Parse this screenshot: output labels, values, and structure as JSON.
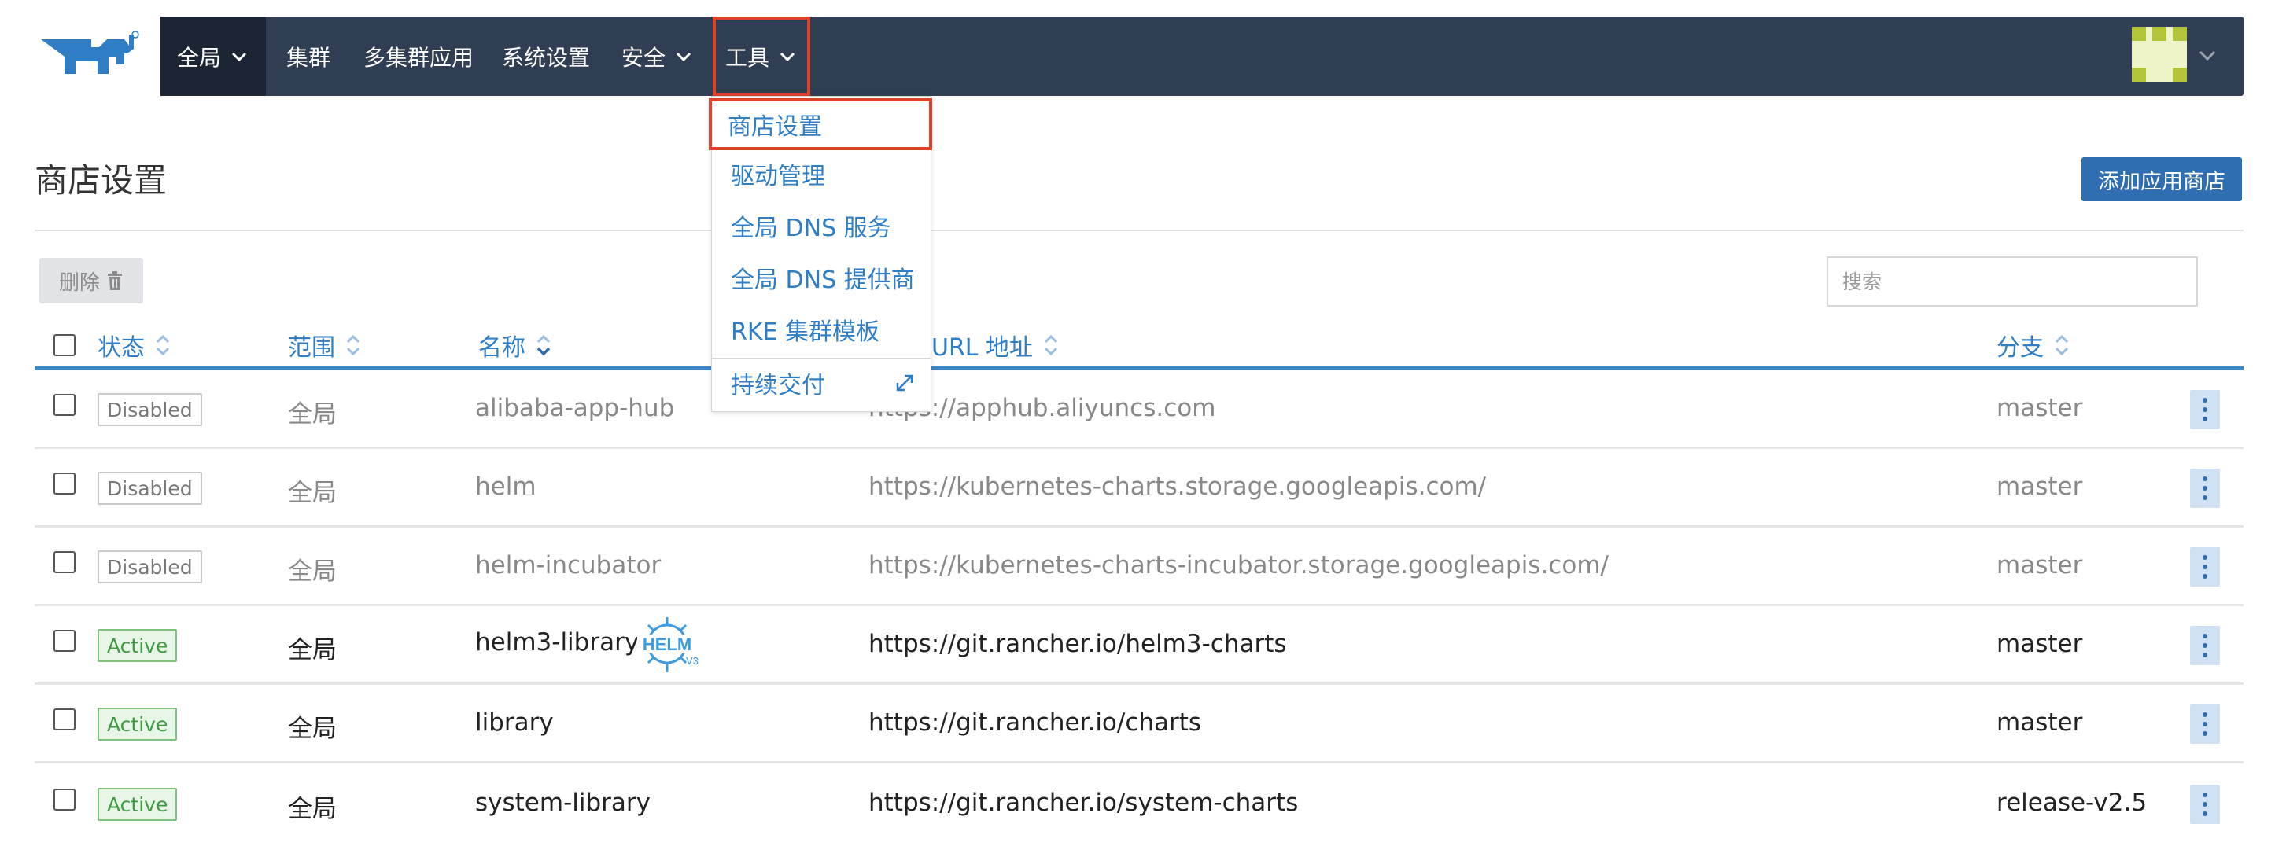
{
  "nav": {
    "items": [
      {
        "label": "全局",
        "has_caret": true
      },
      {
        "label": "集群",
        "has_caret": false
      },
      {
        "label": "多集群应用",
        "has_caret": false
      },
      {
        "label": "系统设置",
        "has_caret": false
      },
      {
        "label": "安全",
        "has_caret": true
      },
      {
        "label": "工具",
        "has_caret": true
      }
    ]
  },
  "tools_menu": {
    "items": [
      {
        "label": "商店设置"
      },
      {
        "label": "驱动管理"
      },
      {
        "label": "全局 DNS 服务"
      },
      {
        "label": "全局 DNS 提供商"
      },
      {
        "label": "RKE 集群模板"
      },
      {
        "label": "持续交付"
      }
    ]
  },
  "page": {
    "title": "商店设置",
    "add_button": "添加应用商店",
    "delete_button": "删除",
    "search_placeholder": "搜索"
  },
  "table": {
    "columns": {
      "state": "状态",
      "scope": "范围",
      "name": "名称",
      "url": "URL 地址",
      "branch": "分支"
    },
    "rows": [
      {
        "state": "Disabled",
        "scope": "全局",
        "name": "alibaba-app-hub",
        "url": "https://apphub.aliyuncs.com",
        "branch": "master"
      },
      {
        "state": "Disabled",
        "scope": "全局",
        "name": "helm",
        "url": "https://kubernetes-charts.storage.googleapis.com/",
        "branch": "master"
      },
      {
        "state": "Disabled",
        "scope": "全局",
        "name": "helm-incubator",
        "url": "https://kubernetes-charts-incubator.storage.googleapis.com/",
        "branch": "master"
      },
      {
        "state": "Active",
        "scope": "全局",
        "name": "helm3-library",
        "url": "https://git.rancher.io/helm3-charts",
        "branch": "master",
        "helm_badge": "HELM",
        "helm_version": "V3"
      },
      {
        "state": "Active",
        "scope": "全局",
        "name": "library",
        "url": "https://git.rancher.io/charts",
        "branch": "master"
      },
      {
        "state": "Active",
        "scope": "全局",
        "name": "system-library",
        "url": "https://git.rancher.io/system-charts",
        "branch": "release-v2.5"
      }
    ]
  },
  "colors": {
    "navbar": "#2f3e52",
    "accent": "#2f7dc5",
    "highlight_border": "#e0412b",
    "active_green": "#3d9a3f"
  }
}
